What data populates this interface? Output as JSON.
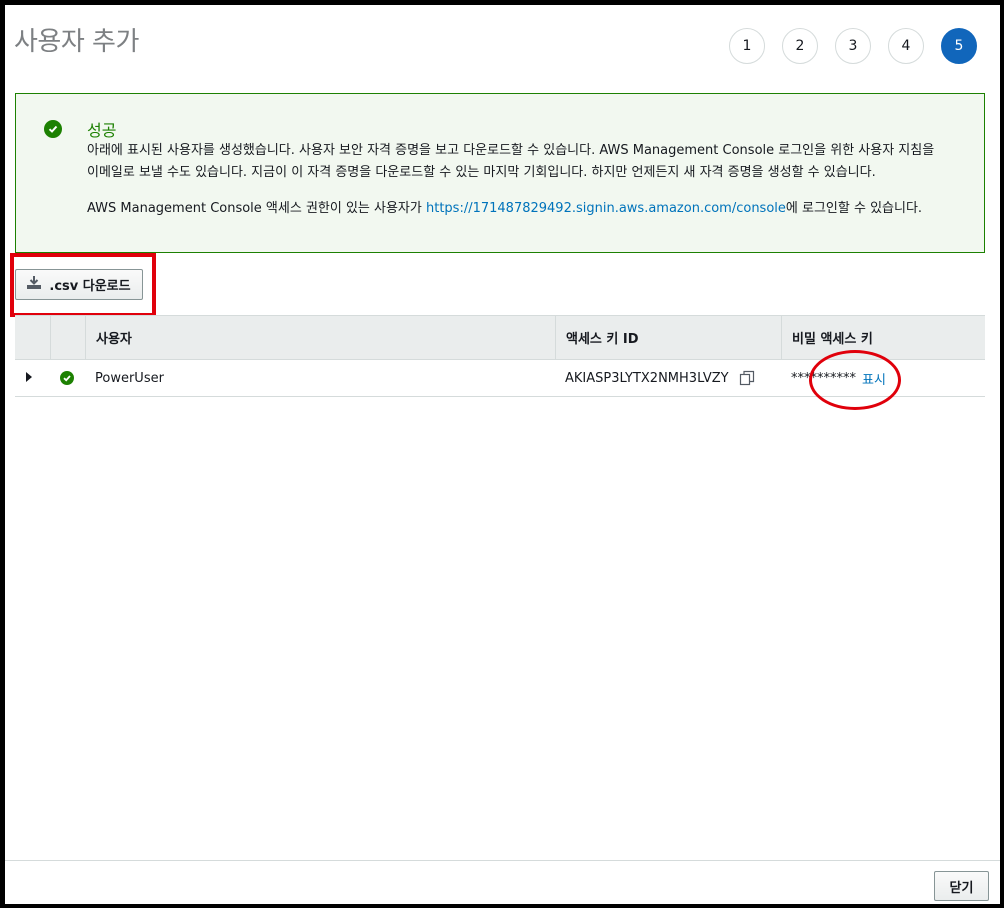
{
  "page": {
    "title": "사용자 추가"
  },
  "steps": [
    "1",
    "2",
    "3",
    "4",
    "5"
  ],
  "active_step": "5",
  "alert": {
    "title": "성공",
    "line1": "아래에 표시된 사용자를 생성했습니다. 사용자 보안 자격 증명을 보고 다운로드할 수 있습니다. AWS Management Console 로그인을 위한 사용자 지침을",
    "line2": "이메일로 보낼 수도 있습니다. 지금이 이 자격 증명을 다운로드할 수 있는 마지막 기회입니다. 하지만 언제든지 새 자격 증명을 생성할 수 있습니다.",
    "console_prefix": "AWS Management Console 액세스 권한이 있는 사용자가 ",
    "console_url": "https://171487829492.signin.aws.amazon.com/console",
    "console_suffix": "에 로그인할 수 있습니다."
  },
  "csv_button": {
    "label": ".csv 다운로드"
  },
  "table": {
    "headers": [
      "사용자",
      "액세스 키 ID",
      "비밀 액세스 키"
    ],
    "rows": [
      {
        "user": "PowerUser",
        "access_key_id": "AKIASP3LYTX2NMH3LVZY",
        "secret_masked": "**********",
        "show_label": "표시"
      }
    ]
  },
  "footer": {
    "close_label": "닫기"
  },
  "colors": {
    "success": "#1d8102",
    "link": "#0073bb",
    "active_step": "#1166bb",
    "highlight": "#e0000b"
  }
}
